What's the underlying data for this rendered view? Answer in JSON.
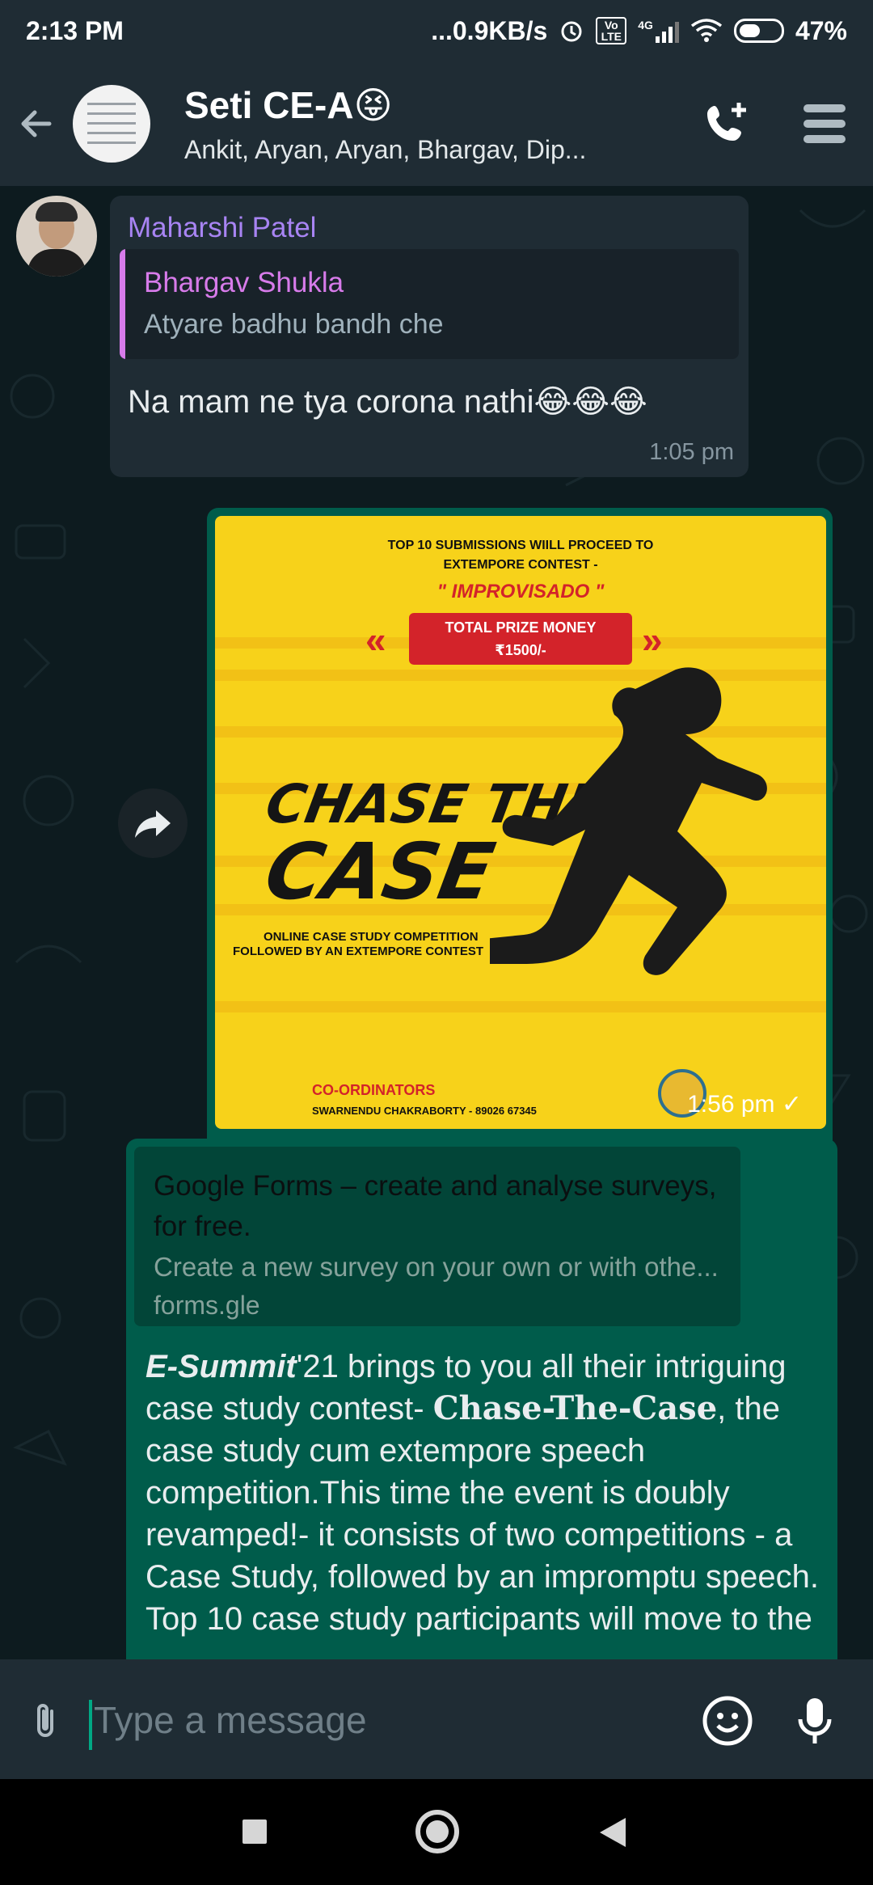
{
  "status_bar": {
    "time": "2:13 PM",
    "network_speed": "...0.9KB/s",
    "network_type": "4G",
    "volte_label": "Vo LTE",
    "battery": "47%"
  },
  "header": {
    "title": "Seti CE-A",
    "title_emoji": "😝",
    "subtitle": "Ankit, Aryan, Aryan, Bhargav, Dip..."
  },
  "messages": {
    "incoming": {
      "sender": "Maharshi Patel",
      "quoted_sender": "Bhargav Shukla",
      "quoted_text": "Atyare badhu bandh che",
      "text": "Na mam ne tya corona nathi😂😂😂",
      "time": "1:05 pm"
    },
    "outgoing_image": {
      "time": "1:56 pm",
      "status": "sent",
      "poster": {
        "line1": "TOP 10 SUBMISSIONS WIILL PROCEED TO",
        "line2": "EXTEMPORE CONTEST -",
        "improvisado": "\" IMPROVISADO \"",
        "prize_line1": "TOTAL PRIZE MONEY",
        "prize_line2": "₹1500/-",
        "title1": "CHASE THE",
        "title2": "CASE",
        "sub1": "ONLINE CASE STUDY COMPETITION",
        "sub2": "FOLLOWED BY AN EXTEMPORE CONTEST",
        "coordinators": "CO-ORDINATORS",
        "coordinator_name": "SWARNENDU CHAKRABORTY - 89026 67345"
      }
    },
    "outgoing_link": {
      "preview_title": "Google Forms – create and analyse surveys, for free.",
      "preview_desc": "Create a new survey on your own or with othe...",
      "preview_url": "forms.gle",
      "text_bold1": "E-Summit",
      "text_part1": "'21 brings to you all their intriguing case study contest-",
      "text_bold2": "Chase-The-Case",
      "text_part2": ", the case study cum extempore speech competition.This time the event is doubly revamped!- it consists of two competitions -  a Case Study, followed by an impromptu speech. Top 10 case study participants will move to the"
    }
  },
  "input": {
    "placeholder": "Type a message"
  },
  "colors": {
    "header_bg": "#1f2c34",
    "chat_bg": "#0d1b1f",
    "incoming_bubble": "#1f2c34",
    "outgoing_bubble": "#005c4b",
    "accent": "#00a884"
  },
  "icons": {
    "back": "arrow-left-icon",
    "call": "add-call-icon",
    "menu": "menu-icon",
    "forward": "forward-icon",
    "attach": "paperclip-icon",
    "emoji": "emoji-icon",
    "mic": "mic-icon"
  }
}
